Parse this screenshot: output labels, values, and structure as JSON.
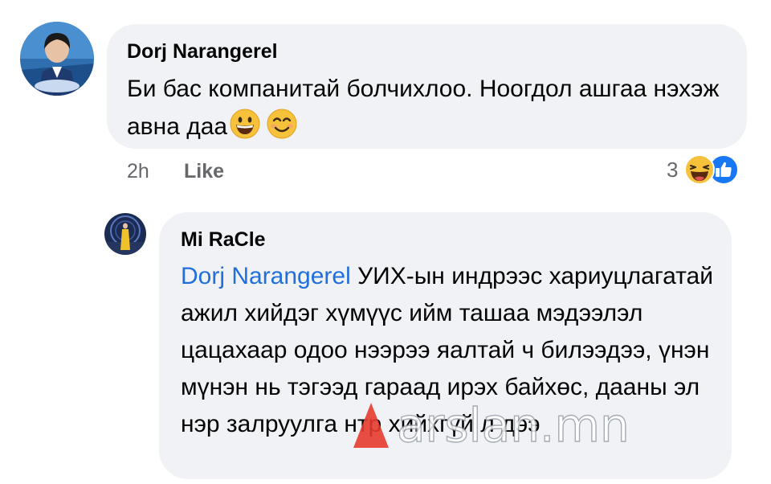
{
  "comment": {
    "author": "Dorj Narangerel",
    "text": "Би бас компанитай болчихлоо. Ноогдол ашгаа нэхэж авна даа",
    "emojis": [
      "grinning-face",
      "smiling-face"
    ],
    "time": "2h",
    "like_label": "Like",
    "reaction_count": "3",
    "reaction_icons": [
      "laughing-face",
      "like-thumb"
    ]
  },
  "reply": {
    "author": "Mi RaCle",
    "mention": "Dorj Narangerel",
    "text": "УИХ-ын индрээс хариуцлагатай ажил хийдэг хүмүүс ийм ташаа мэдээлэл цацахаар одоо нээрээ яалтай ч билээдээ, үнэн мүнэн нь тэгээд гараад ирэх байхөс, дааны эл нэр залруулга нтр хийхгүй л дээ"
  },
  "watermark": {
    "text": "arslan.mn",
    "color": "#e63b2e"
  }
}
